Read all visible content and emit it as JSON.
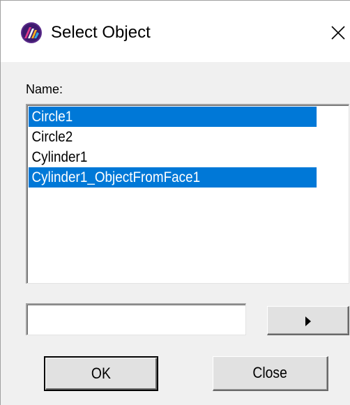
{
  "window": {
    "title": "Select Object",
    "icon": "app-logo-icon",
    "close_icon": "close-icon"
  },
  "name_label": "Name:",
  "objects": [
    {
      "label": "Circle1",
      "selected": true
    },
    {
      "label": "Circle2",
      "selected": false
    },
    {
      "label": "Cylinder1",
      "selected": false
    },
    {
      "label": "Cylinder1_ObjectFromFace1",
      "selected": true
    }
  ],
  "filter_input": {
    "value": ""
  },
  "arrow_button": {
    "icon": "play-arrow-icon"
  },
  "buttons": {
    "ok": "OK",
    "close": "Close"
  },
  "colors": {
    "selection": "#0078d7",
    "window": "#f0f0f0"
  }
}
